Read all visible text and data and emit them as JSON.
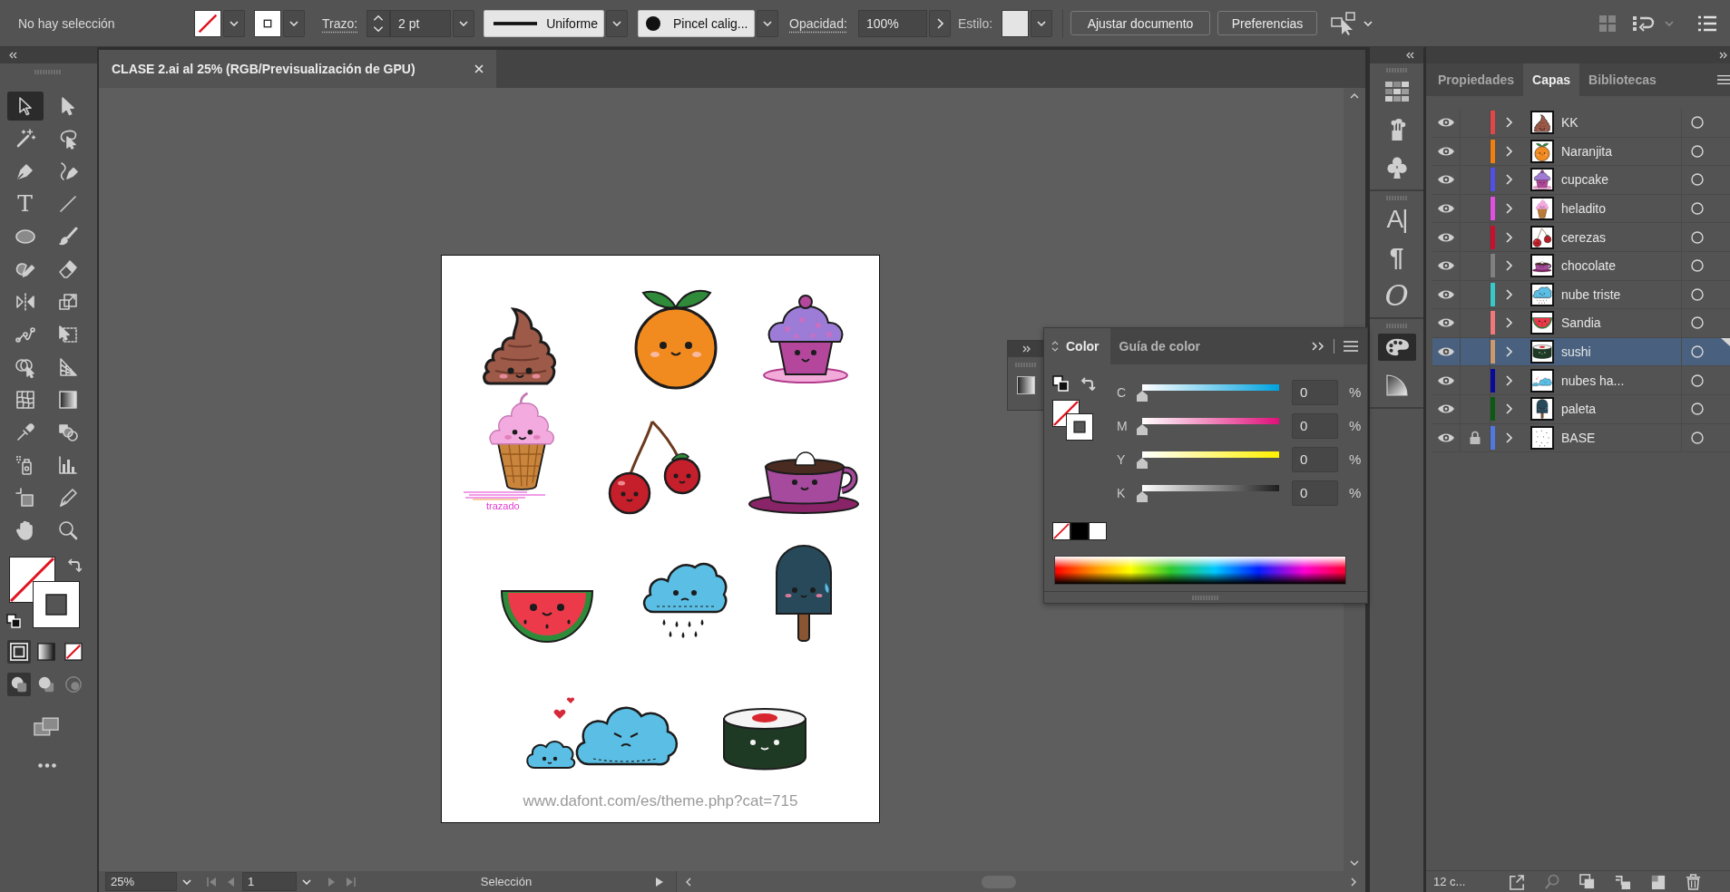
{
  "control_bar": {
    "selection": "No hay selección",
    "stroke_label": "Trazo:",
    "stroke_weight": "2 pt",
    "stroke_profile": "Uniforme",
    "brush": "Pincel calig...",
    "opacity_label": "Opacidad:",
    "opacity": "100%",
    "style_label": "Estilo:",
    "buttons": [
      "Ajustar documento",
      "Preferencias"
    ],
    "arrange_tools": [
      {
        "disabled": true
      },
      {
        "disabled": false
      },
      {
        "disabled": false
      }
    ]
  },
  "tools": [
    {
      "selected": true
    },
    {
      "selected": false
    },
    {
      "selected": false
    },
    {
      "selected": false
    },
    {
      "selected": false
    },
    {
      "selected": false
    },
    {
      "selected": false,
      "glyph": "T"
    },
    {
      "selected": false
    },
    {
      "selected": false
    },
    {
      "selected": false
    },
    {
      "selected": false
    },
    {
      "selected": false
    },
    {
      "selected": false
    },
    {
      "selected": false
    },
    {
      "selected": false
    },
    {
      "selected": false
    },
    {
      "selected": false
    },
    {
      "selected": false
    },
    {
      "selected": false
    },
    {
      "selected": false
    },
    {
      "selected": false
    },
    {
      "selected": false
    },
    {
      "selected": false
    },
    {
      "selected": false
    },
    {
      "selected": false
    },
    {
      "selected": false
    },
    {
      "selected": false
    },
    {
      "selected": false
    }
  ],
  "fill_modes": [
    {
      "selected": true
    },
    {
      "selected": false
    },
    {
      "selected": false
    }
  ],
  "draw_modes": [
    {
      "selected": true,
      "disabled": false
    },
    {
      "selected": false,
      "disabled": false
    },
    {
      "selected": false,
      "disabled": true
    }
  ],
  "document": {
    "tab_title": "CLASE 2.ai al 25% (RGB/Previsualización de GPU)",
    "path_label": "trazado",
    "artboard_text": "www.dafont.com/es/theme.php?cat=715"
  },
  "status_bar": {
    "zoom": "25%",
    "artboard_number": "1",
    "nav_buttons": [
      {
        "disabled": true
      },
      {
        "disabled": true
      },
      {
        "disabled": true
      },
      {
        "disabled": true
      }
    ],
    "tool": "Selección"
  },
  "color_panel": {
    "tabs": [
      {
        "label": "Color",
        "selected": true
      },
      {
        "label": "Guía de color",
        "selected": false
      }
    ],
    "channels": [
      {
        "label": "C",
        "level": 0,
        "value": "0",
        "unit": "%"
      },
      {
        "label": "M",
        "level": 0,
        "value": "0",
        "unit": "%"
      },
      {
        "label": "Y",
        "level": 0,
        "value": "0",
        "unit": "%"
      },
      {
        "label": "K",
        "level": 0,
        "value": "0",
        "unit": "%"
      }
    ]
  },
  "dock": [
    {
      "items": [
        {
          "kind": "swatches",
          "selected": false
        },
        {
          "kind": "brushes",
          "selected": false
        },
        {
          "kind": "symbols",
          "selected": false
        }
      ]
    },
    {
      "items": [
        {
          "kind": "character",
          "glyph": "A|",
          "selected": false
        },
        {
          "kind": "paragraph",
          "glyph": "¶",
          "selected": false
        },
        {
          "kind": "opentype",
          "glyph": "O",
          "selected": false
        }
      ]
    },
    {
      "items": [
        {
          "kind": "color",
          "selected": true
        },
        {
          "kind": "transparency",
          "selected": false
        }
      ]
    }
  ],
  "layers_panel": {
    "tabs": [
      {
        "label": "Propiedades",
        "selected": false
      },
      {
        "label": "Capas",
        "selected": true
      },
      {
        "label": "Bibliotecas",
        "selected": false
      }
    ],
    "layers": [
      {
        "name": "KK",
        "color": "#e04848",
        "visible": true,
        "locked": false,
        "selected": false
      },
      {
        "name": "Naranjita",
        "color": "#f07f10",
        "visible": true,
        "locked": false,
        "selected": false
      },
      {
        "name": "cupcake",
        "color": "#5050e6",
        "visible": true,
        "locked": false,
        "selected": false
      },
      {
        "name": "heladito",
        "color": "#e050e0",
        "visible": true,
        "locked": false,
        "selected": false
      },
      {
        "name": "cerezas",
        "color": "#c8102e",
        "visible": true,
        "locked": false,
        "selected": false
      },
      {
        "name": "chocolate",
        "color": "#808080",
        "visible": true,
        "locked": false,
        "selected": false
      },
      {
        "name": "nube triste",
        "color": "#38c8c8",
        "visible": true,
        "locked": false,
        "selected": false
      },
      {
        "name": "Sandia",
        "color": "#f07878",
        "visible": true,
        "locked": false,
        "selected": false
      },
      {
        "name": "sushi",
        "color": "#c89a70",
        "visible": true,
        "locked": false,
        "selected": true
      },
      {
        "name": "nubes ha...",
        "color": "#0a0a9a",
        "visible": true,
        "locked": false,
        "selected": false
      },
      {
        "name": "paleta",
        "color": "#0a5a14",
        "visible": true,
        "locked": false,
        "selected": false
      },
      {
        "name": "BASE",
        "color": "#5078e0",
        "visible": true,
        "locked": true,
        "selected": false
      }
    ],
    "count": "12 c...",
    "actions": [
      {
        "disabled": false
      },
      {
        "disabled": true
      },
      {
        "disabled": false
      },
      {
        "disabled": false
      },
      {
        "disabled": false
      },
      {
        "disabled": false
      }
    ]
  }
}
